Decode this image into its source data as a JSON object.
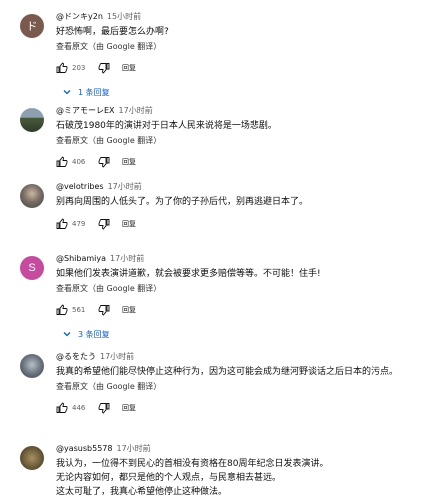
{
  "translate_text": "查看原文（由 Google 翻译）",
  "reply_label": "回复",
  "comments": [
    {
      "avatar_letter": "ド",
      "avatar_color": "#7a5a4e",
      "author": "@ドンキy2n",
      "time": "15小时前",
      "text": "好恐怖啊，最后要怎么办啊?",
      "likes": "203",
      "replies": "1 条回复"
    },
    {
      "avatar_color": "#4a5a3e",
      "author": "@ミアモーレEX",
      "time": "17小时前",
      "text": "石破茂1980年的演讲对于日本人民来说将是一场悲剧。",
      "likes": "406"
    },
    {
      "avatar_color": "#5e6a6e",
      "author": "@velotribes",
      "time": "17小时前",
      "text": "别再向周围的人低头了。为了你的子孙后代，别再逃避日本了。",
      "likes": "479"
    },
    {
      "avatar_letter": "S",
      "avatar_color": "#c64a9d",
      "author": "@Shibamiya",
      "time": "17小时前",
      "text": "如果他们发表演讲道歉，就会被要求更多赔偿等等。不可能！住手!",
      "likes": "561",
      "replies": "3 条回复"
    },
    {
      "avatar_color": "#6c7480",
      "author": "@るをたう",
      "time": "17小时前",
      "text": "我真的希望他们能尽快停止这种行为，因为这可能会成为继河野谈话之后日本的污点。",
      "likes": "446"
    },
    {
      "avatar_color": "#6b5a3a",
      "author": "@yasusb5578",
      "time": "17小时前",
      "text_lines": [
        "我认为，一位得不到民心的首相没有资格在80周年纪念日发表演讲。",
        "无论内容如何，都只是他的个人观点，与民意相去甚远。",
        "这太可耻了，我真心希望他停止这种做法。"
      ]
    }
  ]
}
